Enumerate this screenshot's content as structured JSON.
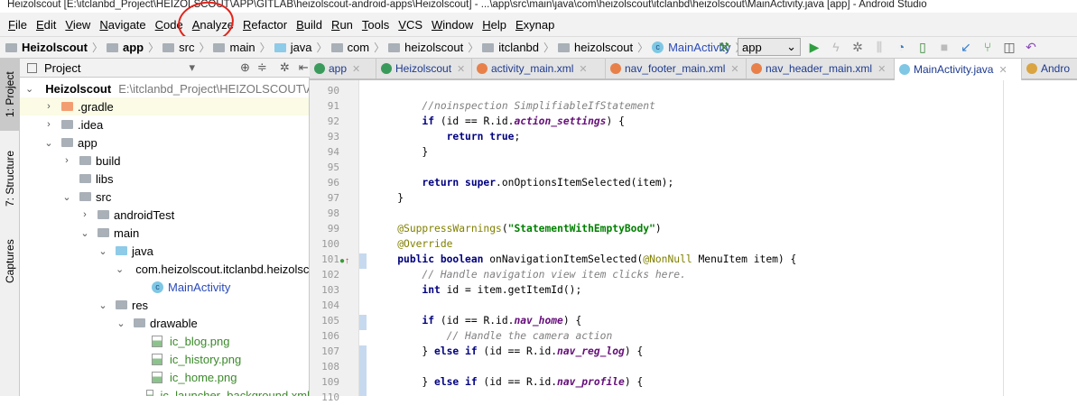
{
  "window": {
    "title": "Heizolscout [E:\\itclanbd_Project\\HEIZOLSCOUT\\APP\\GITLAB\\heizolscout-android-apps\\Heizolscout] - ...\\app\\src\\main\\java\\com\\heizolscout\\itclanbd\\heizolscout\\MainActivity.java [app] - Android Studio"
  },
  "menu": [
    "File",
    "Edit",
    "View",
    "Navigate",
    "Code",
    "Analyze",
    "Refactor",
    "Build",
    "Run",
    "Tools",
    "VCS",
    "Window",
    "Help",
    "Exynap"
  ],
  "breadcrumb": [
    "Heizolscout",
    "app",
    "src",
    "main",
    "java",
    "com",
    "heizolscout",
    "itclanbd",
    "heizolscout",
    "MainActivity"
  ],
  "toolbar": {
    "run_config": "app"
  },
  "side_tabs": [
    "1: Project",
    "7: Structure",
    "Captures"
  ],
  "project_panel": {
    "title": "Project"
  },
  "tree": [
    {
      "label": "Heizolscout",
      "path": "E:\\itclanbd_Project\\HEIZOLSCOUT\\APP",
      "level": 0,
      "open": true,
      "kind": "module"
    },
    {
      "label": ".gradle",
      "level": 1,
      "open": false,
      "kind": "orange"
    },
    {
      "label": ".idea",
      "level": 1,
      "open": false,
      "kind": "folder"
    },
    {
      "label": "app",
      "level": 1,
      "open": true,
      "kind": "folder"
    },
    {
      "label": "build",
      "level": 2,
      "open": false,
      "kind": "folder"
    },
    {
      "label": "libs",
      "level": 2,
      "kind": "folder"
    },
    {
      "label": "src",
      "level": 2,
      "open": true,
      "kind": "folder"
    },
    {
      "label": "androidTest",
      "level": 3,
      "open": false,
      "kind": "folder"
    },
    {
      "label": "main",
      "level": 3,
      "open": true,
      "kind": "folder"
    },
    {
      "label": "java",
      "level": 4,
      "open": true,
      "kind": "blue"
    },
    {
      "label": "com.heizolscout.itclanbd.heizolscout",
      "level": 5,
      "open": true,
      "kind": "folder"
    },
    {
      "label": "MainActivity",
      "level": 6,
      "kind": "class"
    },
    {
      "label": "res",
      "level": 4,
      "open": true,
      "kind": "folder"
    },
    {
      "label": "drawable",
      "level": 5,
      "open": true,
      "kind": "folder"
    },
    {
      "label": "ic_blog.png",
      "level": 6,
      "kind": "image"
    },
    {
      "label": "ic_history.png",
      "level": 6,
      "kind": "image"
    },
    {
      "label": "ic_home.png",
      "level": 6,
      "kind": "image"
    },
    {
      "label": "ic_launcher_background.xml",
      "level": 6,
      "kind": "image"
    }
  ],
  "tabs": [
    {
      "label": "app",
      "icon": "#3a9a5c"
    },
    {
      "label": "Heizolscout",
      "icon": "#3a9a5c"
    },
    {
      "label": "activity_main.xml",
      "icon": "#e8804a"
    },
    {
      "label": "nav_footer_main.xml",
      "icon": "#e8804a"
    },
    {
      "label": "nav_header_main.xml",
      "icon": "#e8804a"
    },
    {
      "label": "MainActivity.java",
      "icon": "#7fc7e4",
      "active": true
    },
    {
      "label": "Andro",
      "icon": "#d9a441"
    }
  ],
  "code": [
    {
      "n": "90",
      "t": []
    },
    {
      "n": "91",
      "t": [
        [
          "        ",
          ""
        ],
        [
          "//noinspection SimplifiableIfStatement",
          "c"
        ]
      ]
    },
    {
      "n": "92",
      "t": [
        [
          "        ",
          ""
        ],
        [
          "if",
          "k"
        ],
        [
          " (id == R.id.",
          ""
        ],
        [
          "action_settings",
          "f"
        ],
        [
          ") {",
          ""
        ]
      ]
    },
    {
      "n": "93",
      "t": [
        [
          "            ",
          ""
        ],
        [
          "return true",
          "k"
        ],
        [
          ";",
          ""
        ]
      ]
    },
    {
      "n": "94",
      "t": [
        [
          "        }",
          ""
        ]
      ]
    },
    {
      "n": "95",
      "t": []
    },
    {
      "n": "96",
      "t": [
        [
          "        ",
          ""
        ],
        [
          "return super",
          "k"
        ],
        [
          ".onOptionsItemSelected(item);",
          ""
        ]
      ]
    },
    {
      "n": "97",
      "t": [
        [
          "    }",
          ""
        ]
      ]
    },
    {
      "n": "98",
      "t": []
    },
    {
      "n": "99",
      "t": [
        [
          "    ",
          ""
        ],
        [
          "@SuppressWarnings",
          "a"
        ],
        [
          "(",
          ""
        ],
        [
          "\"StatementWithEmptyBody\"",
          "s"
        ],
        [
          ")",
          ""
        ]
      ]
    },
    {
      "n": "100",
      "t": [
        [
          "    ",
          ""
        ],
        [
          "@Override",
          "a"
        ]
      ]
    },
    {
      "n": "101",
      "t": [
        [
          "    ",
          ""
        ],
        [
          "public boolean",
          "k"
        ],
        [
          " onNavigationItemSelected(",
          ""
        ],
        [
          "@NonNull",
          "a"
        ],
        [
          " MenuItem item) {",
          ""
        ]
      ]
    },
    {
      "n": "102",
      "t": [
        [
          "        ",
          ""
        ],
        [
          "// Handle navigation view item clicks here.",
          "c"
        ]
      ]
    },
    {
      "n": "103",
      "t": [
        [
          "        ",
          ""
        ],
        [
          "int",
          "k"
        ],
        [
          " id = item.getItemId();",
          ""
        ]
      ]
    },
    {
      "n": "104",
      "t": []
    },
    {
      "n": "105",
      "t": [
        [
          "        ",
          ""
        ],
        [
          "if",
          "k"
        ],
        [
          " (id == R.id.",
          ""
        ],
        [
          "nav_home",
          "f"
        ],
        [
          ") {",
          ""
        ]
      ]
    },
    {
      "n": "106",
      "t": [
        [
          "            ",
          ""
        ],
        [
          "// Handle the camera action",
          "c"
        ]
      ]
    },
    {
      "n": "107",
      "t": [
        [
          "        } ",
          ""
        ],
        [
          "else if",
          "k"
        ],
        [
          " (id == R.id.",
          ""
        ],
        [
          "nav_reg_log",
          "f"
        ],
        [
          ") {",
          ""
        ]
      ]
    },
    {
      "n": "108",
      "t": []
    },
    {
      "n": "109",
      "t": [
        [
          "        } ",
          ""
        ],
        [
          "else if",
          "k"
        ],
        [
          " (id == R.id.",
          ""
        ],
        [
          "nav_profile",
          "f"
        ],
        [
          ") {",
          ""
        ]
      ]
    },
    {
      "n": "110",
      "t": []
    }
  ]
}
